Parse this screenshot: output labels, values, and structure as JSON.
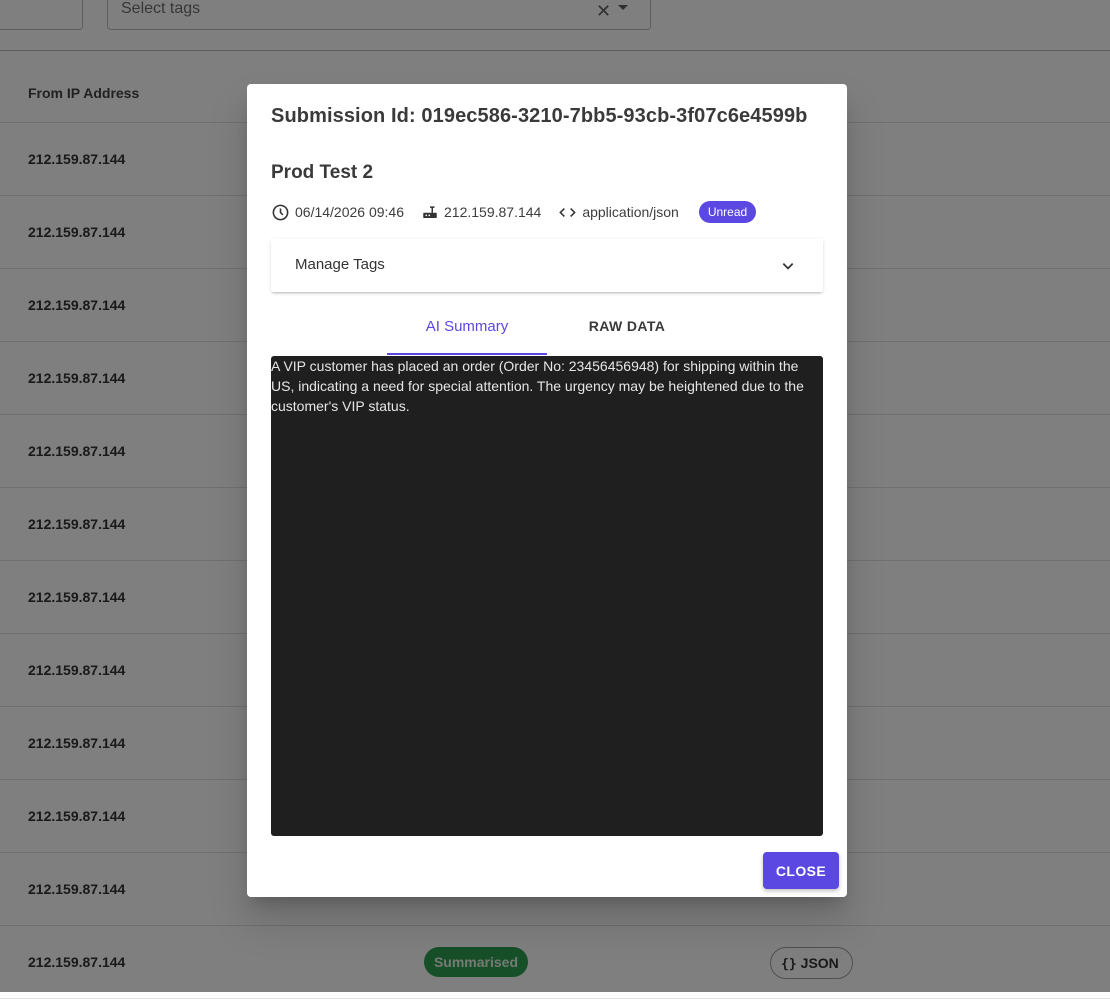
{
  "filters": {
    "tags_placeholder": "Select tags"
  },
  "table": {
    "headers": {
      "ip": "From IP Address"
    },
    "rows": [
      {
        "ip": "212.159.87.144"
      },
      {
        "ip": "212.159.87.144"
      },
      {
        "ip": "212.159.87.144"
      },
      {
        "ip": "212.159.87.144"
      },
      {
        "ip": "212.159.87.144"
      },
      {
        "ip": "212.159.87.144"
      },
      {
        "ip": "212.159.87.144"
      },
      {
        "ip": "212.159.87.144"
      },
      {
        "ip": "212.159.87.144"
      },
      {
        "ip": "212.159.87.144"
      },
      {
        "ip": "212.159.87.144"
      },
      {
        "ip": "212.159.87.144",
        "status": "Summarised",
        "format": "JSON"
      }
    ]
  },
  "dialog": {
    "title": "Submission Id: 019ec586-3210-7bb5-93cb-3f07c6e4599b",
    "name": "Prod Test 2",
    "meta": {
      "datetime": "06/14/2026 09:46",
      "ip": "212.159.87.144",
      "content_type": "application/json",
      "badge": "Unread"
    },
    "manage_tags_label": "Manage Tags",
    "tabs": {
      "ai_summary": "AI Summary",
      "raw_data": "RAW DATA"
    },
    "summary_text": "A VIP customer has placed an order (Order No: 23456456948) for shipping within the US, indicating a need for special attention. The urgency may be heightened due to the customer's VIP status.",
    "close_label": "CLOSE"
  },
  "colors": {
    "accent": "#5b48e3",
    "status_green": "#2e9e52",
    "summary_bg": "#1f1f1f"
  }
}
